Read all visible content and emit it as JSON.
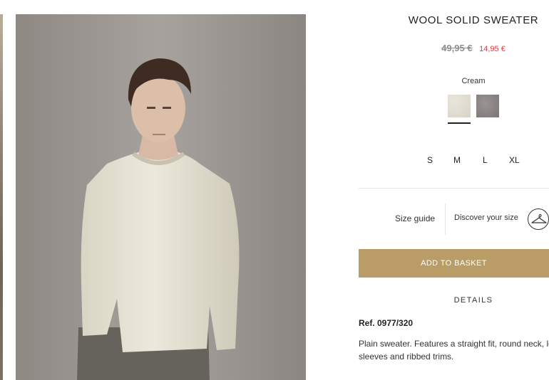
{
  "product": {
    "title": "WOOL SOLID SWEATER",
    "price_old": "49,95 €",
    "price_new": "14,95 €",
    "color_selected": "Cream",
    "colors": [
      {
        "name": "cream",
        "hex": "#e0dccf"
      },
      {
        "name": "grey",
        "hex": "#8a8382"
      }
    ],
    "sizes": [
      "S",
      "M",
      "L",
      "XL"
    ],
    "size_guide_label": "Size guide",
    "discover_size_label": "Discover your size",
    "add_to_basket_label": "ADD TO BASKET",
    "details_label": "DETAILS",
    "reference": "Ref. 0977/320",
    "description_line1": "Plain sweater. Features a straight fit, round neck, long",
    "description_line2": "sleeves and ribbed trims."
  },
  "colors": {
    "accent_button": "#b99c66",
    "sale_price": "#e0393e",
    "old_price": "#8d8d8d"
  },
  "icons": {
    "hanger": "hanger-icon"
  }
}
